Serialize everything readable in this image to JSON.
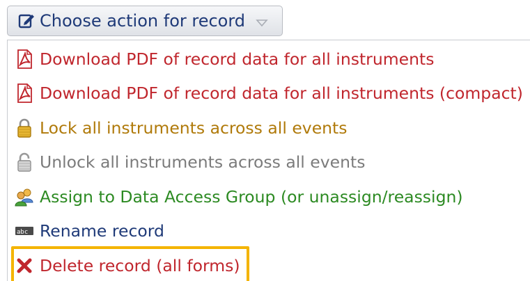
{
  "dropdown": {
    "label": "Choose action for record",
    "icon": "edit-icon",
    "caret_icon": "caret-down-icon"
  },
  "menu": {
    "items": [
      {
        "label": "Download PDF of record data for all instruments",
        "icon": "pdf-icon",
        "color": "#c0262d"
      },
      {
        "label": "Download PDF of record data for all instruments (compact)",
        "icon": "pdf-icon",
        "color": "#c0262d"
      },
      {
        "label": "Lock all instruments across all events",
        "icon": "lock-icon",
        "color": "#b07a0a"
      },
      {
        "label": "Unlock all instruments across all events",
        "icon": "unlock-icon",
        "color": "#7b7b7b"
      },
      {
        "label": "Assign to Data Access Group (or unassign/reassign)",
        "icon": "user-group-icon",
        "color": "#2c8a22"
      },
      {
        "label": "Rename record",
        "icon": "rename-icon",
        "color": "#1f3a78"
      },
      {
        "label": "Delete record (all forms)",
        "icon": "delete-x-icon",
        "color": "#c0262d"
      }
    ]
  },
  "colors": {
    "highlight": "#f4b400",
    "button_text": "#1f3a78"
  }
}
